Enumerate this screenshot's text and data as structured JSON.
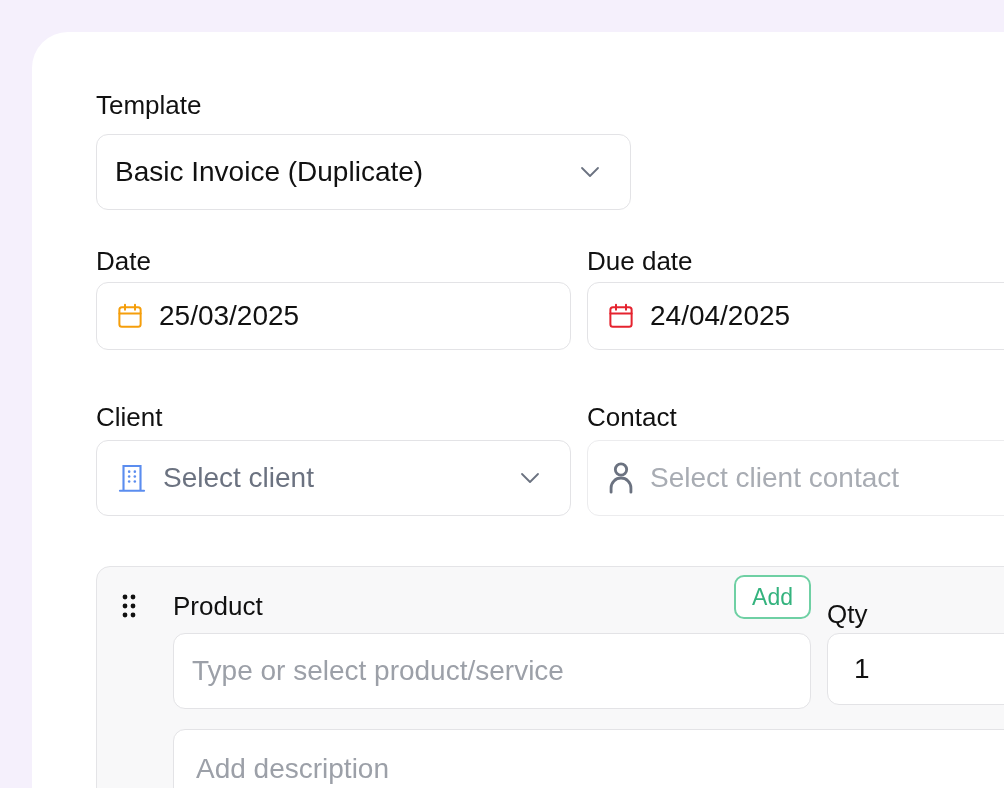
{
  "template": {
    "label": "Template",
    "value": "Basic Invoice (Duplicate)"
  },
  "dates": [
    {
      "label": "Date",
      "value": "25/03/2025",
      "color": "#f59e0b"
    },
    {
      "label": "Due date",
      "value": "24/04/2025",
      "color": "#e5232f"
    }
  ],
  "client": {
    "label": "Client",
    "placeholder": "Select client"
  },
  "contact": {
    "label": "Contact",
    "placeholder": "Select client contact"
  },
  "line_item": {
    "product_label": "Product",
    "add_button": "Add",
    "product_placeholder": "Type or select product/service",
    "qty_label": "Qty",
    "qty_value": "1",
    "description_placeholder": "Add description"
  }
}
